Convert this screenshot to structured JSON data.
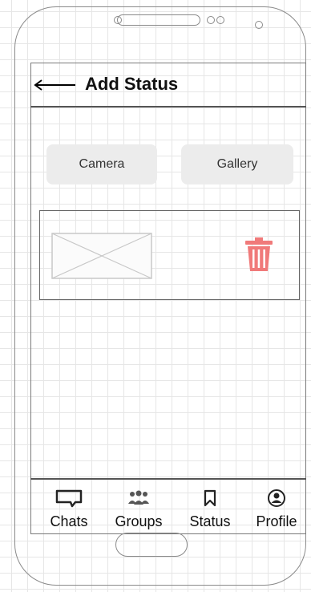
{
  "header": {
    "title": "Add Status",
    "back_icon": "left-arrow-icon"
  },
  "actions": {
    "camera_label": "Camera",
    "gallery_label": "Gallery"
  },
  "status_card": {
    "image_icon": "image-placeholder-icon",
    "delete_icon": "trash-icon",
    "delete_color": "#f07a7a"
  },
  "bottom_nav": [
    {
      "label": "Chats",
      "icon": "chat-bubble-icon"
    },
    {
      "label": "Groups",
      "icon": "groups-icon"
    },
    {
      "label": "Status",
      "icon": "bookmark-icon"
    },
    {
      "label": "Profile",
      "icon": "profile-icon"
    }
  ]
}
